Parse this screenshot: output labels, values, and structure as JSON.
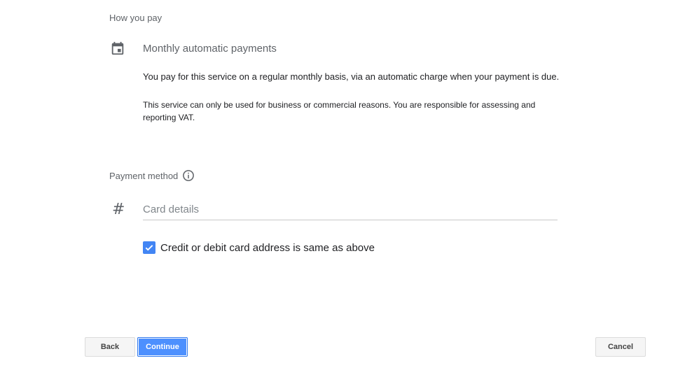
{
  "how_you_pay": {
    "title": "How you pay",
    "icon": "calendar-icon",
    "plan_name": "Monthly automatic payments",
    "description": "You pay for this service on a regular monthly basis, via an automatic charge when your payment is due.",
    "note": "This service can only be used for business or commercial reasons. You are responsible for assessing and reporting VAT."
  },
  "payment_method": {
    "title": "Payment method",
    "info_icon": "info-icon",
    "card_icon": "hash-icon",
    "card_placeholder": "Card details",
    "card_value": "",
    "same_address_label": "Credit or debit card address is same as above",
    "same_address_checked": true
  },
  "buttons": {
    "back": "Back",
    "continue": "Continue",
    "cancel": "Cancel"
  },
  "colors": {
    "accent": "#4285f4",
    "primary_button": "#4d90fe",
    "muted_text": "#5f6368"
  }
}
